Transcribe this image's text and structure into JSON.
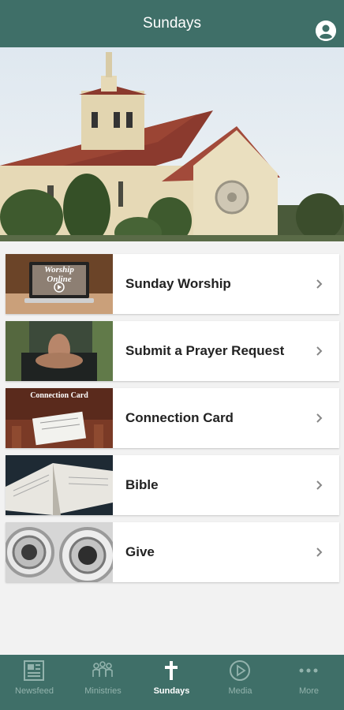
{
  "header": {
    "title": "Sundays",
    "profile_icon": "account-circle-icon"
  },
  "hero": {
    "image": "church-building-photo"
  },
  "menu": {
    "items": [
      {
        "label": "Sunday Worship",
        "thumb_text": "Worship Online"
      },
      {
        "label": "Submit a Prayer Request"
      },
      {
        "label": "Connection Card",
        "thumb_text": "Connection Card"
      },
      {
        "label": "Bible"
      },
      {
        "label": "Give"
      }
    ]
  },
  "tabbar": {
    "tabs": [
      {
        "label": "Newsfeed",
        "icon": "newsfeed-icon"
      },
      {
        "label": "Ministries",
        "icon": "people-group-icon"
      },
      {
        "label": "Sundays",
        "icon": "cross-icon",
        "active": true
      },
      {
        "label": "Media",
        "icon": "play-circle-icon"
      },
      {
        "label": "More",
        "icon": "more-dots-icon"
      }
    ]
  },
  "colors": {
    "brand": "#3f6f68",
    "inactive_tab": "#93b3ad",
    "background": "#f2f2f2"
  }
}
